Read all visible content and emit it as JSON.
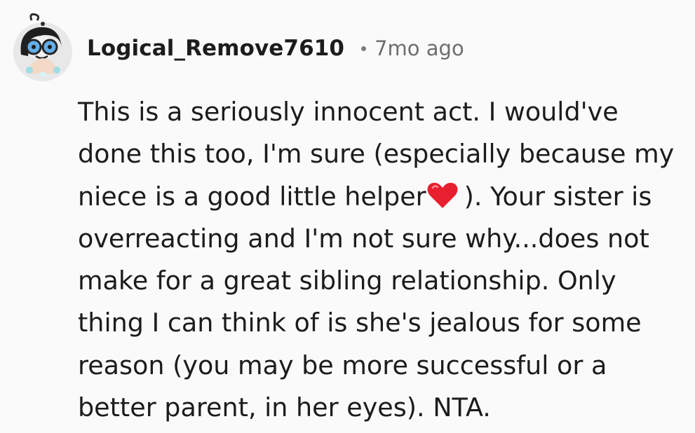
{
  "comment": {
    "username": "Logical_Remove7610",
    "timestamp": "7mo ago",
    "avatar_icon": "snoo-avatar-with-glasses-icon",
    "emoji_icon": "red-heart-icon",
    "body_lines": [
      "This is a seriously innocent act. I would've",
      "done this too, I'm sure (especially because my",
      "niece is a good little helper",
      "). Your sister is",
      "overreacting and I'm not sure why...does not",
      "make for a great sibling relationship. Only",
      "thing I can think of is she's jealous for some",
      "reason (you may be more successful or a",
      "better parent, in her eyes). NTA."
    ]
  }
}
